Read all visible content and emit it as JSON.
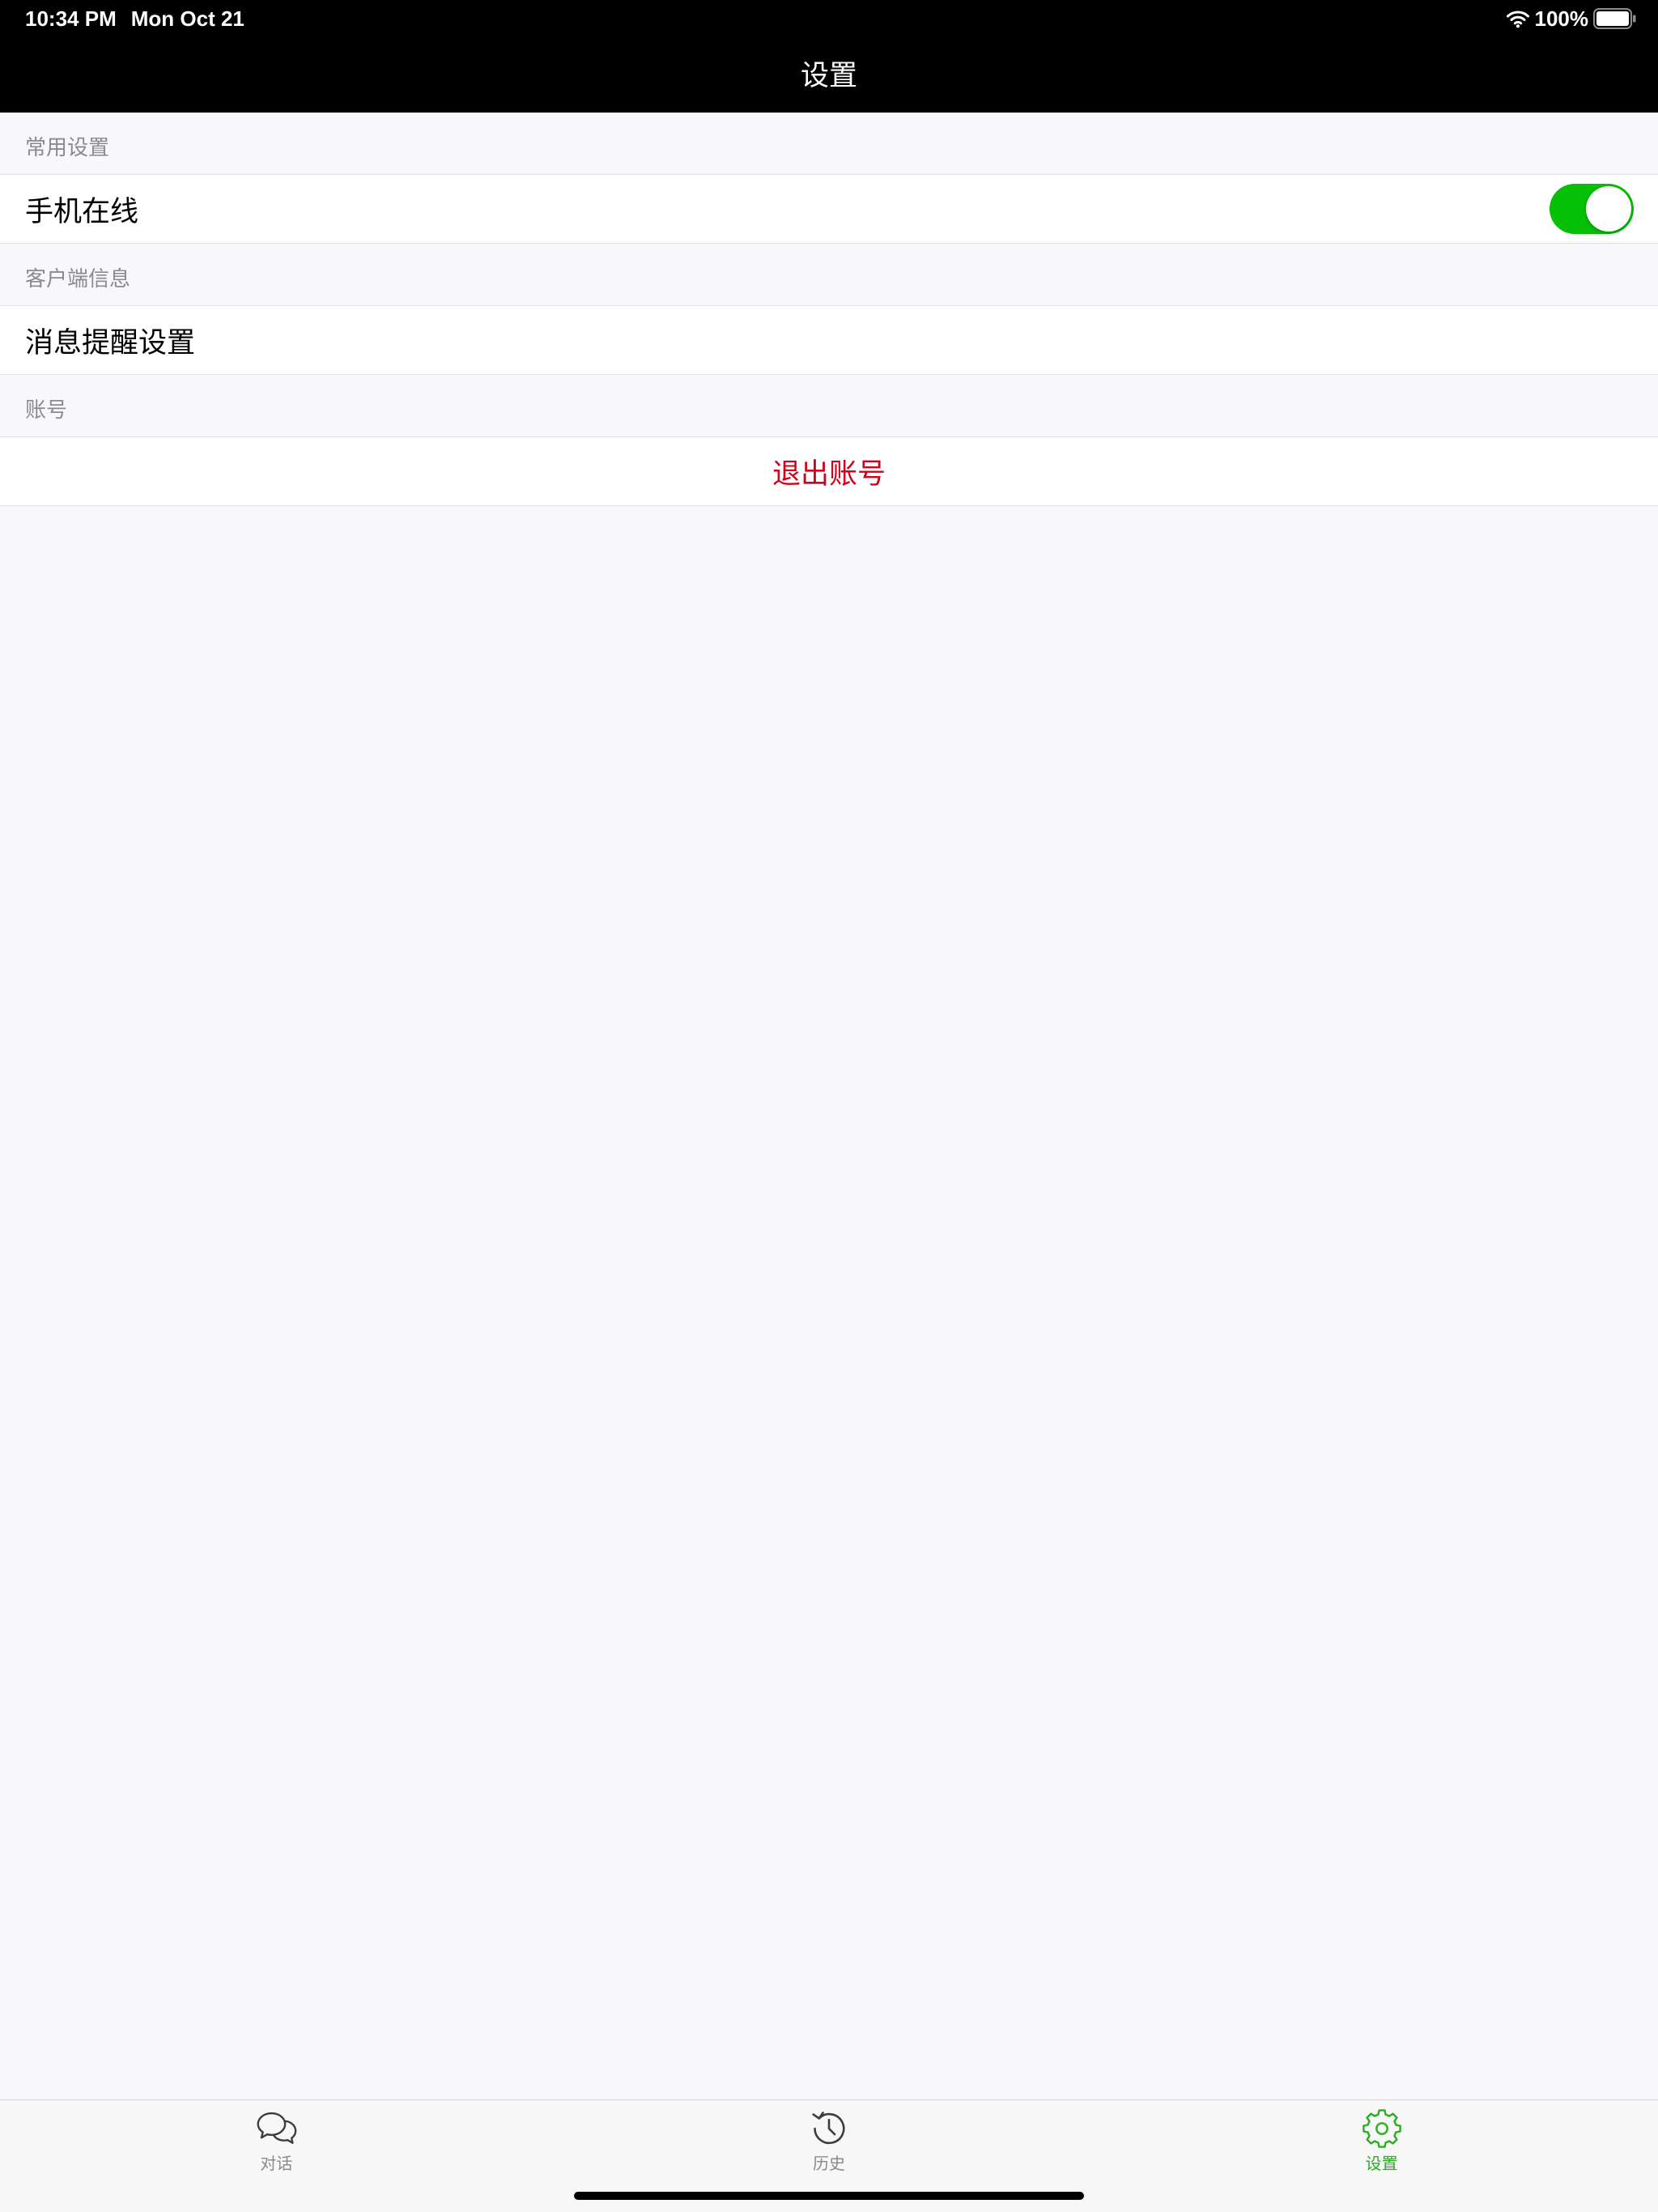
{
  "status_bar": {
    "time": "10:34 PM",
    "date": "Mon Oct 21",
    "battery_text": "100%",
    "battery_level": 1.0
  },
  "nav_bar": {
    "title": "设置"
  },
  "sections": [
    {
      "header": "常用设置",
      "rows": [
        {
          "label": "手机在线",
          "toggle_on": true
        }
      ]
    },
    {
      "header": "客户端信息",
      "rows": [
        {
          "label": "消息提醒设置"
        }
      ]
    },
    {
      "header": "账号",
      "rows": [
        {
          "label": "退出账号",
          "label_color": "#d0021b"
        }
      ]
    }
  ],
  "tab_bar": {
    "items": [
      {
        "label": "对话",
        "icon": "chat-bubbles-icon",
        "selected": false
      },
      {
        "label": "历史",
        "icon": "history-icon",
        "selected": false
      },
      {
        "label": "设置",
        "icon": "gear-icon",
        "selected": true
      }
    ]
  },
  "colors": {
    "nav_background": "#000000",
    "page_background": "#f8f7fc",
    "toggle_on": "#05c005",
    "tab_selected": "#2aae1f",
    "tab_unselected": "#8a8a8a"
  }
}
